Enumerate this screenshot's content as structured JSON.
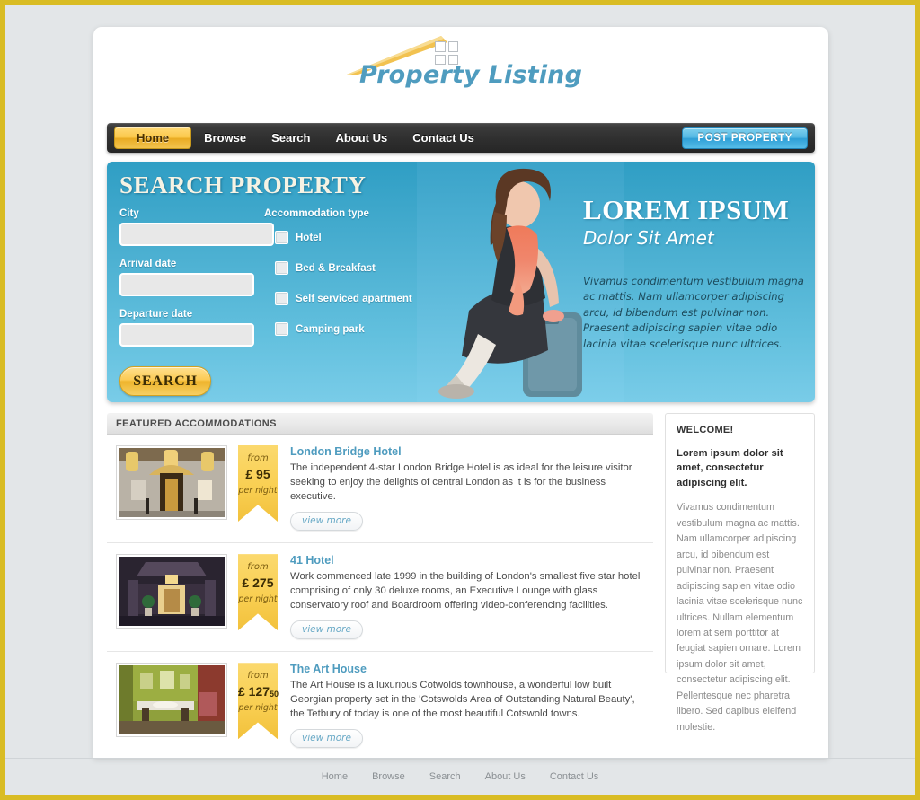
{
  "site": {
    "logo_text": "Property Listing"
  },
  "nav": {
    "items": [
      {
        "label": "Home",
        "active": true
      },
      {
        "label": "Browse",
        "active": false
      },
      {
        "label": "Search",
        "active": false
      },
      {
        "label": "About Us",
        "active": false
      },
      {
        "label": "Contact Us",
        "active": false
      }
    ],
    "post_property_label": "POST PROPERTY"
  },
  "hero": {
    "search_title": "SEARCH PROPERTY",
    "fields": [
      {
        "label": "City",
        "value": "",
        "placeholder": ""
      },
      {
        "label": "Arrival date",
        "value": "",
        "placeholder": ""
      },
      {
        "label": "Departure date",
        "value": "",
        "placeholder": ""
      }
    ],
    "accommodation_title": "Accommodation type",
    "accommodation_types": [
      {
        "label": "Hotel",
        "checked": false
      },
      {
        "label": "Bed & Breakfast",
        "checked": false
      },
      {
        "label": "Self serviced apartment",
        "checked": false
      },
      {
        "label": "Camping park",
        "checked": false
      }
    ],
    "search_button": "SEARCH",
    "headline": "LOREM IPSUM",
    "subheadline": "Dolor Sit Amet",
    "body": "Vivamus condimentum vestibulum magna ac mattis. Nam ullamcorper adipiscing arcu, id bibendum est pulvinar non. Praesent adipiscing sapien vitae odio lacinia vitae scelerisque nunc ultrices.",
    "photo_alt": "woman-sitting-on-suitcase"
  },
  "featured": {
    "header": "FEATURED ACCOMMODATIONS",
    "listings": [
      {
        "title": "London Bridge Hotel",
        "description": "The independent 4-star London Bridge Hotel is as ideal for the leisure visitor seeking to enjoy the delights of central London as it is for the business executive.",
        "price_from": "from",
        "price": "£ 95",
        "price_cents": "",
        "price_per": "per night",
        "view_more": "view more",
        "thumb_alt": "hotel-entrance-photo"
      },
      {
        "title": "41 Hotel",
        "description": "Work commenced late 1999 in the building of London's smallest five star hotel comprising of only 30 deluxe rooms, an Executive Lounge with glass conservatory roof and Boardroom offering video-conferencing facilities.",
        "price_from": "from",
        "price": "£ 275",
        "price_cents": "",
        "price_per": "per night",
        "view_more": "view more",
        "thumb_alt": "hotel-lobby-photo"
      },
      {
        "title": "The Art House",
        "description": "The Art House is a luxurious Cotwolds townhouse, a wonderful low built Georgian property set in the 'Cotswolds Area of Outstanding Natural Beauty', the Tetbury of today is one of the most beautiful Cotswold towns.",
        "price_from": "from",
        "price": "£ 127",
        "price_cents": "50",
        "price_per": "per night",
        "view_more": "view more",
        "thumb_alt": "dining-room-photo"
      }
    ]
  },
  "sidebar": {
    "heading": "WELCOME!",
    "lead": "Lorem ipsum dolor sit amet, consectetur adipiscing elit.",
    "body": "Vivamus condimentum vestibulum magna ac mattis. Nam ullamcorper adipiscing arcu, id bibendum est pulvinar non. Praesent adipiscing sapien vitae odio lacinia vitae scelerisque nunc ultrices. Nullam elementum lorem at sem porttitor at feugiat sapien ornare. Lorem ipsum dolor sit amet, consectetur adipiscing elit. Pellentesque nec pharetra libero. Sed dapibus eleifend molestie."
  },
  "footer": {
    "links": [
      "Home",
      "Browse",
      "Search",
      "About Us",
      "Contact Us"
    ]
  },
  "colors": {
    "accent_gold": "#f2c13c",
    "accent_blue": "#4f9cbf",
    "nav_dark": "#2f2f2f",
    "page_border": "#d9bc24",
    "page_bg": "#e3e6e8"
  }
}
